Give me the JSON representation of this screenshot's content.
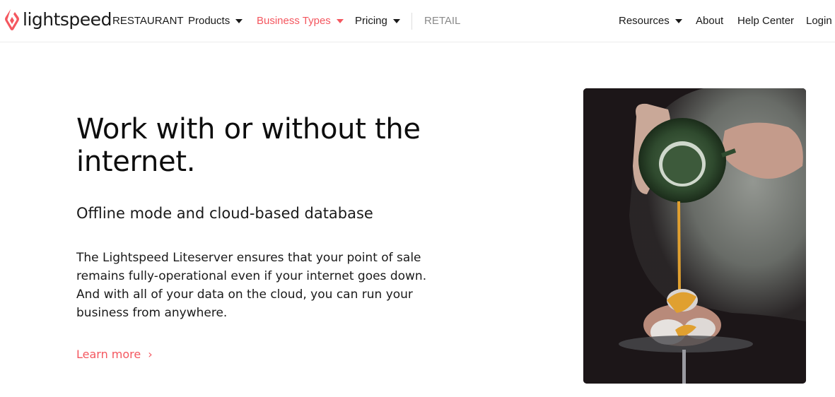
{
  "brand": {
    "name": "lightspeed",
    "accent_color": "#f4575f"
  },
  "nav": {
    "left": [
      {
        "label": "RESTAURANT",
        "dropdown": false,
        "state": "normal"
      },
      {
        "label": "Products",
        "dropdown": true,
        "state": "normal"
      },
      {
        "label": "Business Types",
        "dropdown": true,
        "state": "active"
      },
      {
        "label": "Pricing",
        "dropdown": true,
        "state": "normal"
      },
      {
        "label": "RETAIL",
        "dropdown": false,
        "state": "muted"
      }
    ],
    "right": [
      {
        "label": "Resources",
        "dropdown": true
      },
      {
        "label": "About",
        "dropdown": false
      },
      {
        "label": "Help Center",
        "dropdown": false
      },
      {
        "label": "Login",
        "dropdown": false
      }
    ]
  },
  "hero": {
    "title": "Work with or without the internet.",
    "subtitle": "Offline mode and cloud-based database",
    "body": "The Lightspeed Liteserver ensures that your point of sale remains fully-operational even if your internet goes down. And with all of your data on the cloud, you can run your business from anywhere.",
    "cta_label": "Learn more",
    "cta_icon": "chevron-right-icon",
    "image_alt": "Person pouring orange sauce from a green cup onto sugar-dusted pastries"
  }
}
